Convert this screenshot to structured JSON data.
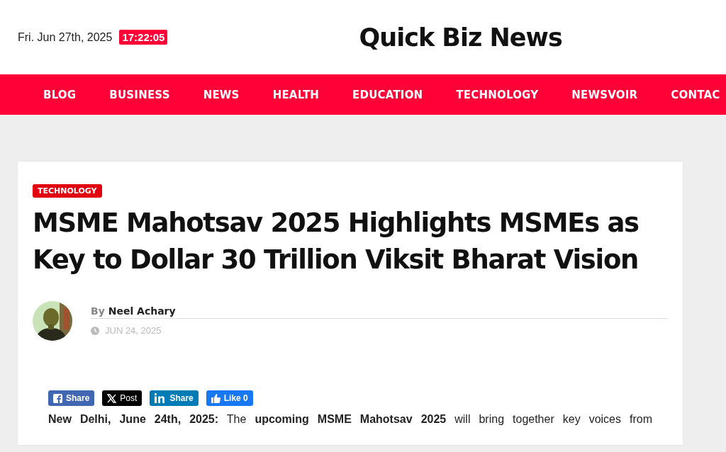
{
  "top_bar": {
    "date": "Fri. Jun 27th, 2025",
    "time": "17:22:05",
    "site_title": "Quick Biz News"
  },
  "nav": {
    "items": [
      {
        "label": "BLOG"
      },
      {
        "label": "BUSINESS"
      },
      {
        "label": "NEWS"
      },
      {
        "label": "HEALTH"
      },
      {
        "label": "EDUCATION"
      },
      {
        "label": "TECHNOLOGY"
      },
      {
        "label": "NEWSVOIR"
      },
      {
        "label": "CONTAC"
      }
    ]
  },
  "article": {
    "category": "TECHNOLOGY",
    "title": "MSME Mahotsav 2025 Highlights MSMEs as Key to Dollar 30 Trillion Viksit Bharat Vision",
    "by": "By",
    "author": "Neel Achary",
    "date": "JUN 24, 2025",
    "share_buttons": [
      {
        "kind": "facebook",
        "label": "Share"
      },
      {
        "kind": "x",
        "label": "Post"
      },
      {
        "kind": "linkedin",
        "label": "Share"
      },
      {
        "kind": "like",
        "label": "Like 0"
      }
    ],
    "body": "**New Delhi, June 24th, 2025:** The **upcoming MSME Mahotsav 2025** will bring together key voices from"
  }
}
